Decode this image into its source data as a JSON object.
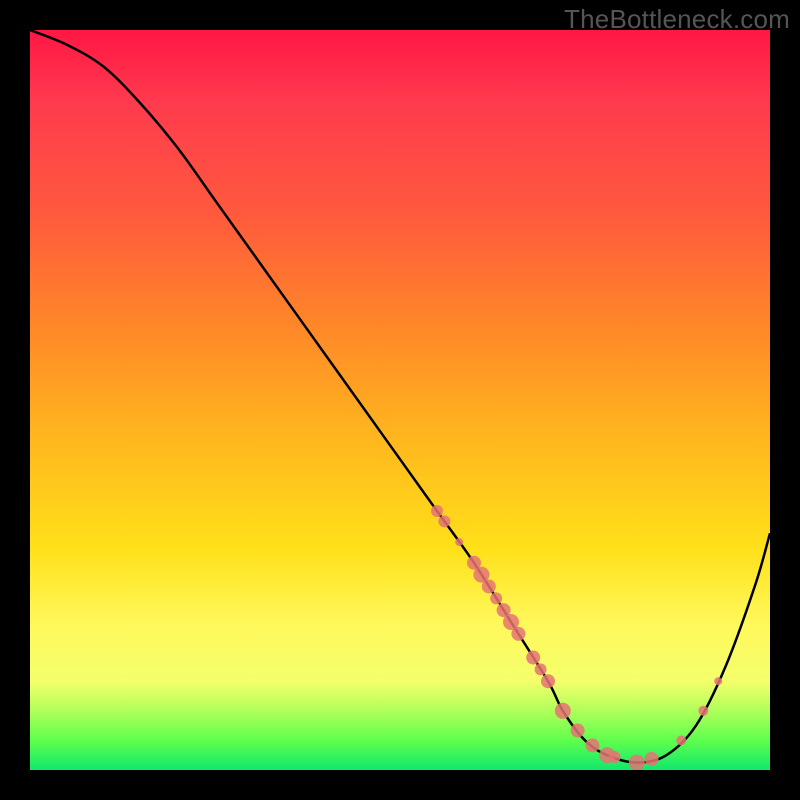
{
  "watermark": "TheBottleneck.com",
  "chart_data": {
    "type": "line",
    "title": "",
    "xlabel": "",
    "ylabel": "",
    "xlim": [
      0,
      100
    ],
    "ylim": [
      0,
      100
    ],
    "curve": {
      "name": "bottleneck-curve",
      "x": [
        0,
        5,
        10,
        15,
        20,
        25,
        30,
        35,
        40,
        45,
        50,
        55,
        60,
        65,
        70,
        72,
        75,
        78,
        82,
        86,
        90,
        94,
        98,
        100
      ],
      "y": [
        100,
        98,
        95,
        90,
        84,
        77,
        70,
        63,
        56,
        49,
        42,
        35,
        28,
        20,
        12,
        8,
        4,
        2,
        1,
        2,
        6,
        14,
        25,
        32
      ]
    },
    "highlight_points": {
      "name": "highlight-points",
      "color": "#e57373",
      "points": [
        {
          "x": 55,
          "r": 6
        },
        {
          "x": 56,
          "r": 6
        },
        {
          "x": 58,
          "r": 4
        },
        {
          "x": 60,
          "r": 7
        },
        {
          "x": 61,
          "r": 8
        },
        {
          "x": 62,
          "r": 7
        },
        {
          "x": 63,
          "r": 6
        },
        {
          "x": 64,
          "r": 7
        },
        {
          "x": 65,
          "r": 8
        },
        {
          "x": 66,
          "r": 7
        },
        {
          "x": 68,
          "r": 7
        },
        {
          "x": 69,
          "r": 6
        },
        {
          "x": 70,
          "r": 7
        },
        {
          "x": 72,
          "r": 8
        },
        {
          "x": 74,
          "r": 7
        },
        {
          "x": 76,
          "r": 7
        },
        {
          "x": 78,
          "r": 8
        },
        {
          "x": 79,
          "r": 6
        },
        {
          "x": 82,
          "r": 8
        },
        {
          "x": 84,
          "r": 7
        },
        {
          "x": 88,
          "r": 5
        },
        {
          "x": 91,
          "r": 5
        },
        {
          "x": 93,
          "r": 4
        }
      ]
    }
  }
}
